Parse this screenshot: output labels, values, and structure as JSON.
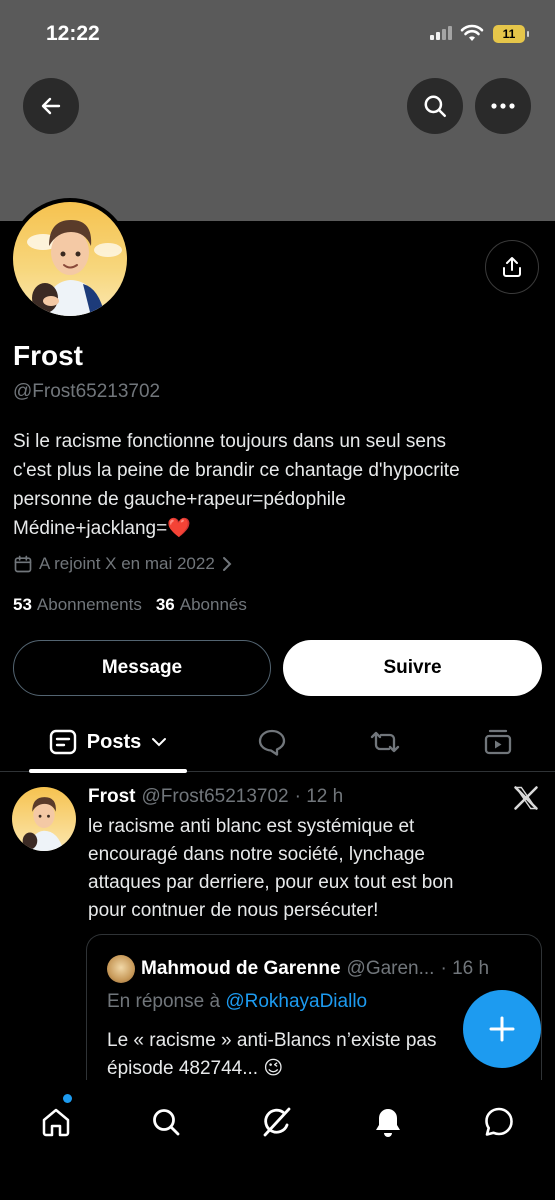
{
  "status_bar": {
    "time": "12:22",
    "battery": "11"
  },
  "profile": {
    "name": "Frost",
    "handle": "@Frost65213702",
    "bio": [
      "Si le racisme fonctionne toujours dans un seul sens",
      "c'est plus la peine de brandir ce chantage d'hypocrite",
      "personne de gauche+rapeur=pédophile",
      "Médine+jacklang=❤️"
    ],
    "joined": "A rejoint X en mai 2022",
    "following_count": "53",
    "following_label": "Abonnements",
    "followers_count": "36",
    "followers_label": "Abonnés"
  },
  "buttons": {
    "message": "Message",
    "follow": "Suivre"
  },
  "tabs": {
    "posts": "Posts"
  },
  "post": {
    "author": "Frost",
    "handle": "@Frost65213702",
    "time": "· 12 h",
    "text": [
      "le racisme anti blanc est systémique et",
      "encouragé dans notre société, lynchage",
      "attaques par derriere, pour eux tout est bon",
      "pour contnuer de nous persécuter!"
    ],
    "quote": {
      "author": "Mahmoud de Garenne",
      "handle": "@Garen...",
      "time": "· 16 h",
      "reply_prefix": "En réponse à",
      "reply_to": "@RokhayaDiallo",
      "text": [
        "Le « racisme » anti-Blancs n’existe pas",
        "épisode 482744... 😉"
      ]
    }
  },
  "icons": {
    "back": "arrow-left-icon",
    "search": "search-icon",
    "more": "more-horizontal-icon",
    "share": "share-icon",
    "calendar": "calendar-icon",
    "chevron": "chevron-right-icon",
    "posts_tab": "posts-tab-icon",
    "replies_tab": "reply-bubble-icon",
    "reposts_tab": "repost-icon",
    "media_tab": "media-icon",
    "x_logo": "x-logo-icon",
    "fab": "plus-icon",
    "nav": [
      "home-icon",
      "search-icon",
      "grok-icon",
      "bell-icon",
      "mail-bubble-icon"
    ]
  },
  "colors": {
    "accent": "#1d9bf0",
    "muted": "#71767b",
    "background": "#000000",
    "banner": "#5a5a5a"
  }
}
